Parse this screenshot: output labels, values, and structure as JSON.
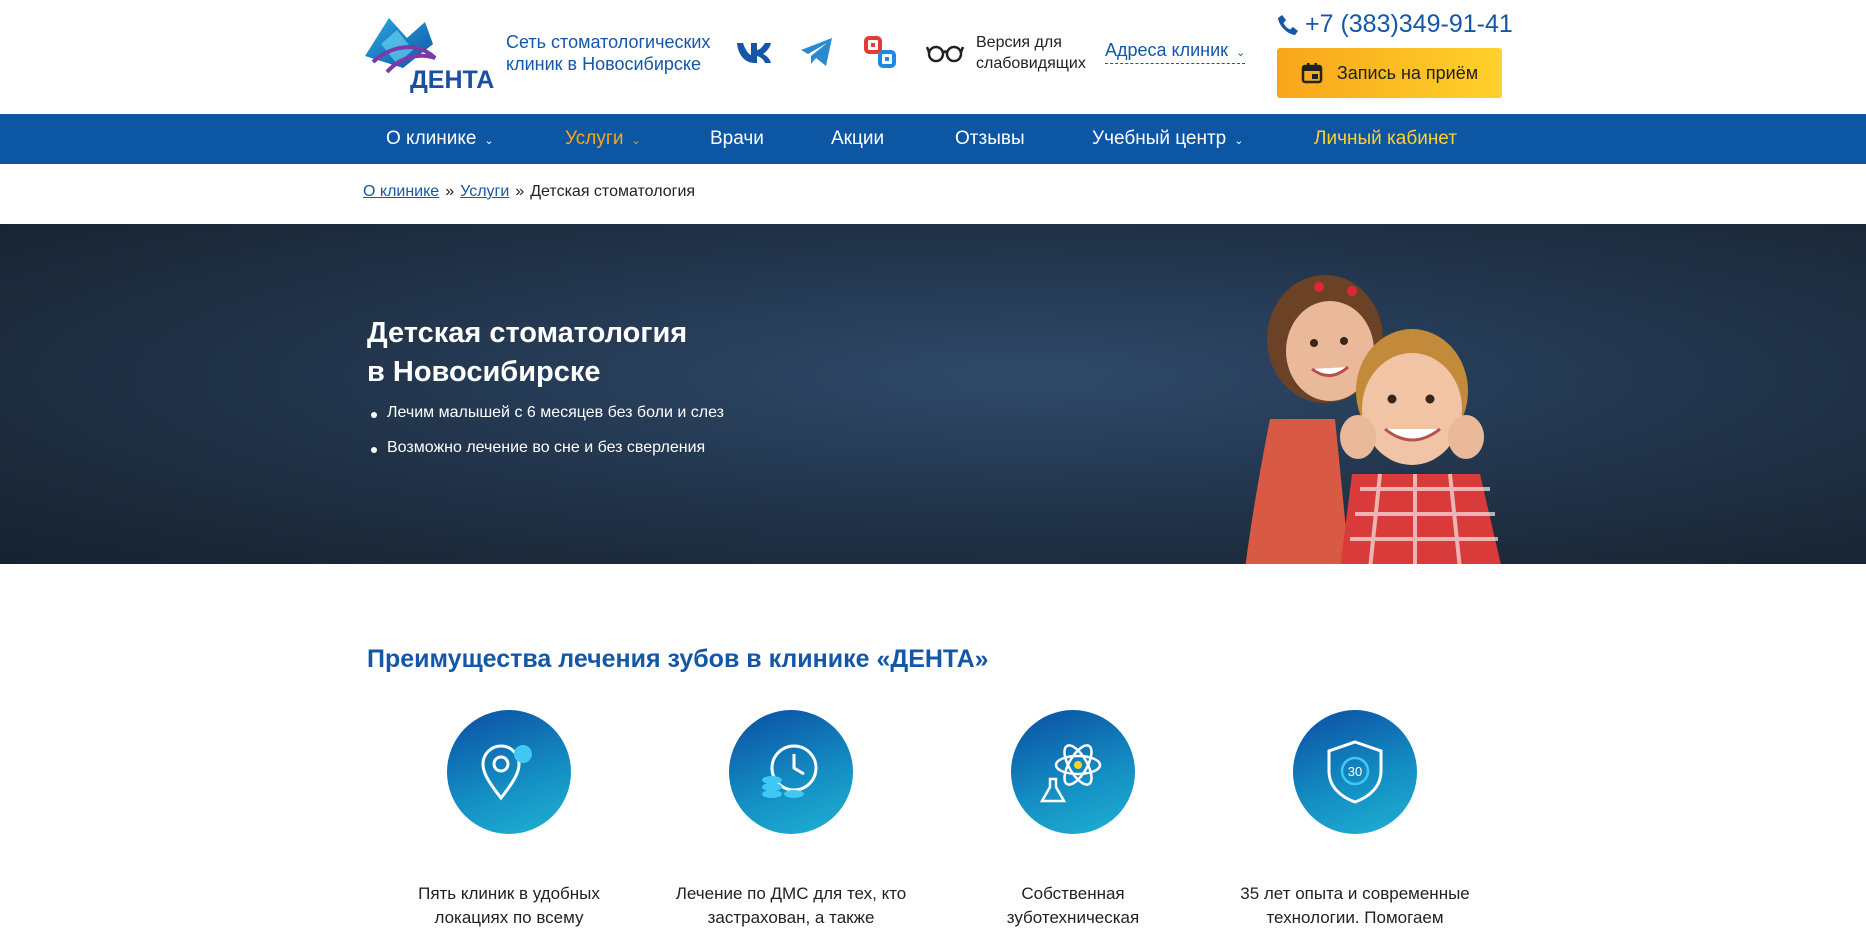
{
  "header": {
    "logo_text": "ДЕНТА",
    "tagline": "Сеть стоматологических клиник в Новосибирске",
    "social_icons": [
      "vk-icon",
      "telegram-icon",
      "rutube-icon"
    ],
    "vision_label": "Версия для слабовидящих",
    "addresses_label": "Адреса клиник",
    "phone": "+7 (383)349-91-41",
    "book_label": "Запись на приём"
  },
  "nav": {
    "items": [
      {
        "label": "О клинике",
        "dropdown": true
      },
      {
        "label": "Услуги",
        "dropdown": true,
        "active": true
      },
      {
        "label": "Врачи"
      },
      {
        "label": "Акции"
      },
      {
        "label": "Отзывы"
      },
      {
        "label": "Учебный центр",
        "dropdown": true
      },
      {
        "label": "Личный кабинет"
      }
    ]
  },
  "breadcrumbs": {
    "items": [
      "О клинике",
      "Услуги",
      "Детская стоматология"
    ],
    "separator": "»"
  },
  "hero": {
    "title_line1": "Детская стоматология",
    "title_line2": "в Новосибирске",
    "bullets": [
      "Лечим малышей с 6 месяцев без боли и слез",
      "Возможно лечение во сне и без сверления"
    ]
  },
  "advantages": {
    "title": "Преимущества лечения зубов в клинике «ДЕНТА»",
    "items": [
      {
        "icon": "location-pin-icon",
        "text_line1": "Пять клиник в удобных",
        "text_line2": "локациях по всему"
      },
      {
        "icon": "clock-coins-icon",
        "text_line1": "Лечение по ДМС для тех, кто",
        "text_line2": "застрахован, а также"
      },
      {
        "icon": "atom-flask-icon",
        "text_line1": "Собственная",
        "text_line2": "зуботехническая"
      },
      {
        "icon": "shield-30-icon",
        "text_line1": "35 лет опыта и современные",
        "text_line2": "технологии. Помогаем",
        "badge": "30"
      }
    ]
  },
  "colors": {
    "primary": "#0d56a4",
    "link": "#1557a7",
    "accent": "#f8a51b",
    "accent_light": "#ffd22b",
    "hero_bg": "#1c2a3b"
  }
}
